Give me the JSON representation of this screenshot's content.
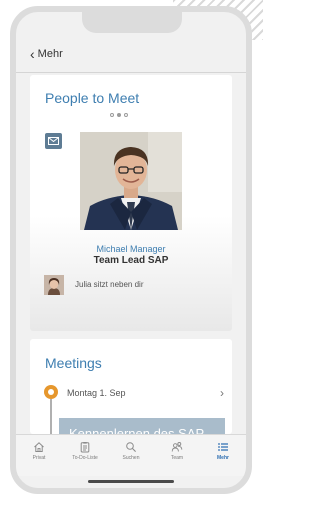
{
  "nav": {
    "back_label": "Mehr"
  },
  "people_card": {
    "title": "People to Meet",
    "pager": {
      "count": 3,
      "active_index": 1
    },
    "person": {
      "name": "Michael Manager",
      "role": "Team Lead SAP"
    },
    "seat_note": "Julia sitzt neben dir",
    "icons": {
      "mail": "mail-icon"
    }
  },
  "meetings_card": {
    "title": "Meetings",
    "date": "Montag 1. Sep",
    "meeting_title": "Kennenlernen des SAP Teams"
  },
  "tabbar": {
    "tabs": [
      {
        "label": "Privat",
        "icon": "home-icon",
        "active": false
      },
      {
        "label": "To-Do-Liste",
        "icon": "checklist-icon",
        "active": false
      },
      {
        "label": "Suchen",
        "icon": "search-icon",
        "active": false
      },
      {
        "label": "Team",
        "icon": "team-icon",
        "active": false
      },
      {
        "label": "Mehr",
        "icon": "list-icon",
        "active": true
      }
    ]
  },
  "colors": {
    "accent_blue": "#3e7eb0",
    "active_tab": "#2f6fb2",
    "timeline_orange": "#e6972d",
    "meeting_box": "#a9bccb"
  }
}
